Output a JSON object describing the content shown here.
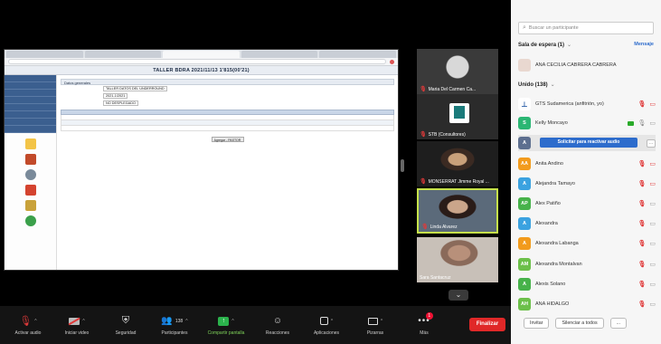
{
  "shared_screen": {
    "browser_tabs": [
      "",
      "",
      "",
      "",
      ""
    ],
    "url": "",
    "app_title": "TALLER BDRA 2021/11/13 1'815(00'21)",
    "panel_title": "Datos generales",
    "form": [
      {
        "label": "",
        "value": "TALLER DATOS DEL UNDERROUND"
      },
      {
        "label": "",
        "value": "2021-1/2021"
      },
      {
        "label": "",
        "value": "NO DESPLEGADO"
      }
    ],
    "grid_headers": [
      "",
      "",
      "",
      "",
      "",
      ""
    ],
    "save_label": "Agregar - PASTOR"
  },
  "thumbnails": [
    {
      "name": "Maria Del Carmen Ca..."
    },
    {
      "name": "STB (Consultores)"
    },
    {
      "name": "MONSERRAT Jimme Royal ..."
    },
    {
      "name": "Linda Alvarez"
    },
    {
      "name": "Sara Santacruz"
    }
  ],
  "toolbar": {
    "buttons": [
      {
        "label": "Activar audio",
        "icon": "mic-muted-icon"
      },
      {
        "label": "Iniciar video",
        "icon": "video-off-icon"
      },
      {
        "label": "Seguridad",
        "icon": "shield-icon"
      },
      {
        "label": "Participantes",
        "icon": "participants-icon",
        "count": "138"
      },
      {
        "label": "Compartir pantalla",
        "icon": "share-screen-icon"
      },
      {
        "label": "Reacciones",
        "icon": "reactions-icon"
      },
      {
        "label": "Aplicaciones",
        "icon": "apps-icon"
      },
      {
        "label": "Pizarras",
        "icon": "whiteboard-icon"
      },
      {
        "label": "Más",
        "icon": "more-icon",
        "badge": "1"
      }
    ],
    "end_label": "Finalizar"
  },
  "participants": {
    "search_placeholder": "Buscar un participante",
    "waiting": {
      "title": "Sala de espera (1)",
      "message_label": "Mensaje",
      "person": {
        "name": "ANA CECILIA CABRERA CABRERA"
      }
    },
    "joined_title": "Unido (138)",
    "unmute_request_label": "Solicitar para reactivar audio",
    "people": [
      {
        "initials": "",
        "name": "GTS Sudamerica (anfitrión, yo)",
        "color": "#ffffff"
      },
      {
        "initials": "S",
        "name": "Kelly Moncayo",
        "color": "#2bb673"
      },
      {
        "initials": "A",
        "name": "",
        "color": "#5d6f8f"
      },
      {
        "initials": "AA",
        "name": "Anita Andino",
        "color": "#f29b1d"
      },
      {
        "initials": "A",
        "name": "Alejandra Tamayo",
        "color": "#3ba2e0"
      },
      {
        "initials": "AP",
        "name": "Alex Patiño",
        "color": "#47b24a"
      },
      {
        "initials": "A",
        "name": "Alexandra",
        "color": "#3ba2e0"
      },
      {
        "initials": "A",
        "name": "Alexandra Labanga",
        "color": "#f29b1d"
      },
      {
        "initials": "AM",
        "name": "Alexandra Montalvan",
        "color": "#6cc04a"
      },
      {
        "initials": "A",
        "name": "Alexis Solano",
        "color": "#47b24a"
      },
      {
        "initials": "AH",
        "name": "ANA HIDALGO",
        "color": "#6cc04a"
      }
    ],
    "footer": {
      "invite_label": "Invitar",
      "mute_all_label": "Silenciar a todos",
      "more_label": "..."
    }
  }
}
